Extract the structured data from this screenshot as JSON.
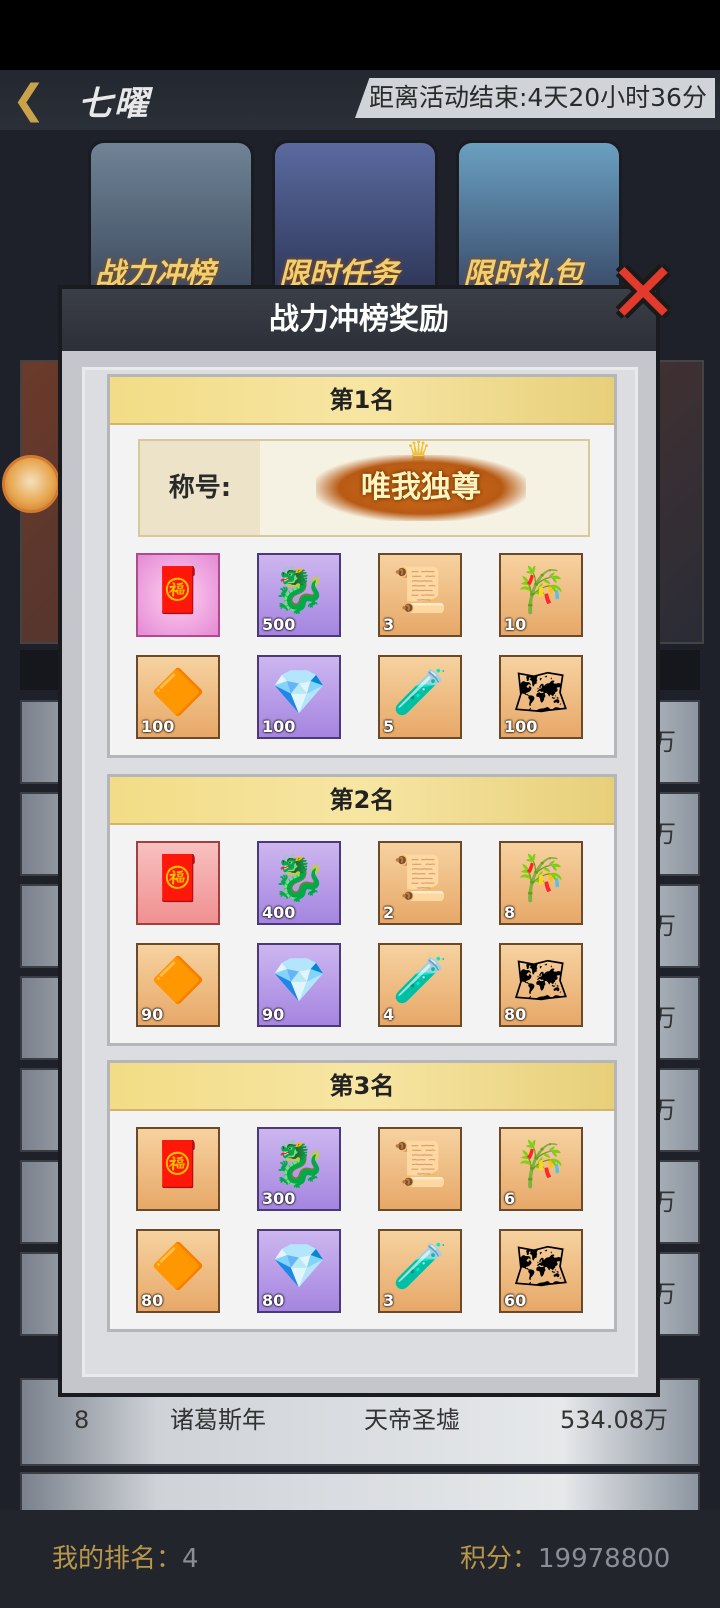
{
  "header": {
    "title": "七曜",
    "countdown": "距离活动结束:4天20小时36分"
  },
  "event_tabs": [
    {
      "label": "战力冲榜"
    },
    {
      "label": "限时任务"
    },
    {
      "label": "限时礼包"
    }
  ],
  "background_list": {
    "row8": {
      "rank": "8",
      "name": "诸葛斯年",
      "server": "天帝圣墟",
      "power": "534.08万"
    },
    "partial_suffix": "万"
  },
  "bottom": {
    "my_rank_label": "我的排名：",
    "my_rank_value": "4",
    "score_label": "积分：",
    "score_value": "19978800"
  },
  "modal": {
    "title": "战力冲榜奖励",
    "ranks": [
      {
        "name": "第1名",
        "title_label": "称号:",
        "title_badge": "唯我独尊",
        "items": [
          {
            "icon": "red-envelope-icon",
            "qty": ""
          },
          {
            "icon": "jade-pendant-icon",
            "qty": "500"
          },
          {
            "icon": "talisman-icon",
            "qty": "3"
          },
          {
            "icon": "scroll-icon",
            "qty": "10"
          },
          {
            "icon": "orange-gem-icon",
            "qty": "100"
          },
          {
            "icon": "purple-gem-icon",
            "qty": "100"
          },
          {
            "icon": "potion-icon",
            "qty": "5"
          },
          {
            "icon": "parchment-icon",
            "qty": "100"
          }
        ]
      },
      {
        "name": "第2名",
        "items": [
          {
            "icon": "red-envelope-icon",
            "qty": ""
          },
          {
            "icon": "jade-pendant-icon",
            "qty": "400"
          },
          {
            "icon": "talisman-icon",
            "qty": "2"
          },
          {
            "icon": "scroll-icon",
            "qty": "8"
          },
          {
            "icon": "orange-gem-icon",
            "qty": "90"
          },
          {
            "icon": "purple-gem-icon",
            "qty": "90"
          },
          {
            "icon": "potion-icon",
            "qty": "4"
          },
          {
            "icon": "parchment-icon",
            "qty": "80"
          }
        ]
      },
      {
        "name": "第3名",
        "items": [
          {
            "icon": "red-envelope-icon",
            "qty": ""
          },
          {
            "icon": "jade-pendant-icon",
            "qty": "300"
          },
          {
            "icon": "talisman-icon",
            "qty": ""
          },
          {
            "icon": "scroll-icon",
            "qty": "6"
          },
          {
            "icon": "orange-gem-icon",
            "qty": "80"
          },
          {
            "icon": "purple-gem-icon",
            "qty": "80"
          },
          {
            "icon": "potion-icon",
            "qty": "3"
          },
          {
            "icon": "parchment-icon",
            "qty": "60"
          }
        ]
      }
    ]
  }
}
